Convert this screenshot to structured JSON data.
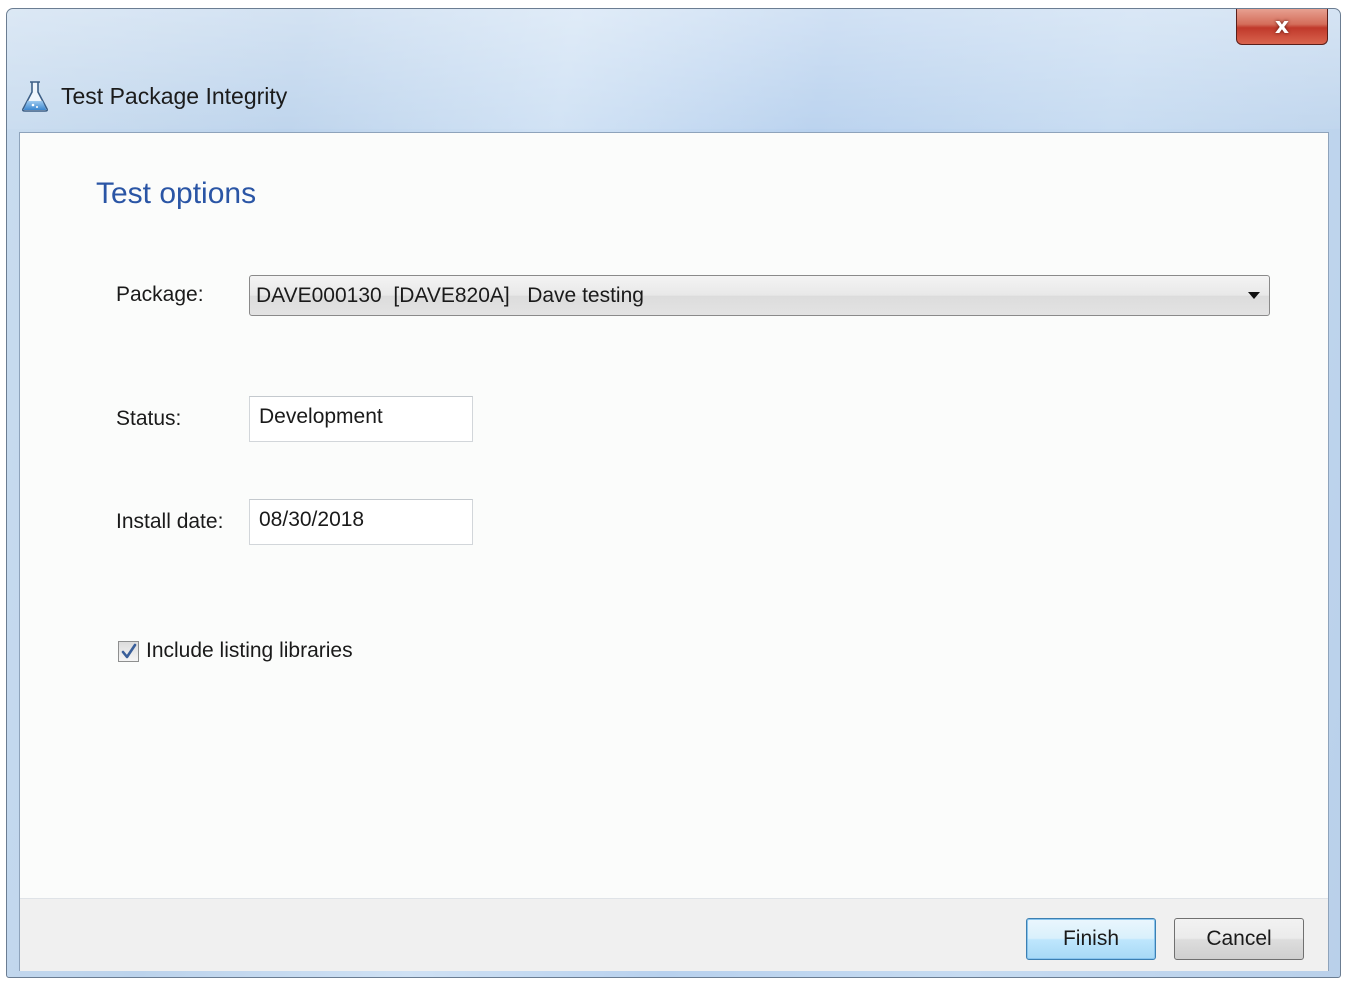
{
  "window": {
    "title": "Test Package Integrity",
    "title_icon": "flask-icon",
    "close_glyph": "x",
    "accent_color": "#2a55a5"
  },
  "form": {
    "section_title": "Test options",
    "package": {
      "label": "Package:",
      "value": "DAVE000130  [DAVE820A]   Dave testing"
    },
    "status": {
      "label": "Status:",
      "value": "Development"
    },
    "install_date": {
      "label": "Install date:",
      "value": "08/30/2018"
    },
    "include_listing_libraries": {
      "label": "Include listing libraries",
      "checked": true
    }
  },
  "buttons": {
    "finish": "Finish",
    "cancel": "Cancel"
  }
}
